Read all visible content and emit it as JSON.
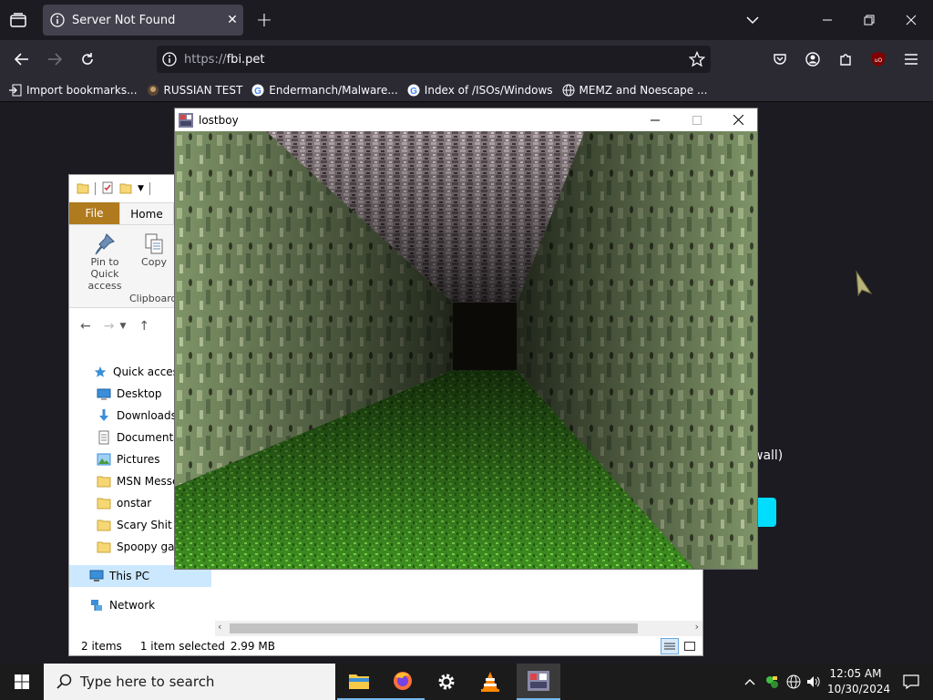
{
  "browser": {
    "tab_title": "Server Not Found",
    "url_scheme": "https://",
    "url_host": "fbi.pet",
    "bookmarks": [
      {
        "label": "Import bookmarks...",
        "icon": "import-icon"
      },
      {
        "label": "RUSSIAN TEST",
        "icon": "site-icon"
      },
      {
        "label": "Endermanch/Malware...",
        "icon": "chrome-favicon"
      },
      {
        "label": "Index of /ISOs/Windows",
        "icon": "chrome-favicon"
      },
      {
        "label": "MEMZ and Noescape ...",
        "icon": "globe-icon"
      }
    ],
    "error_fragment": "wall)",
    "accent_color": "#00ddff"
  },
  "explorer": {
    "tabs": {
      "file": "File",
      "home": "Home"
    },
    "ribbon": {
      "pin_label": "Pin to Quick access",
      "copy_label": "Copy",
      "group_label": "Clipboard"
    },
    "nav": [
      {
        "label": "Quick access",
        "icon": "star-icon"
      },
      {
        "label": "Desktop",
        "icon": "desktop-icon"
      },
      {
        "label": "Downloads",
        "icon": "download-icon"
      },
      {
        "label": "Documents",
        "icon": "document-icon"
      },
      {
        "label": "Pictures",
        "icon": "pictures-icon"
      },
      {
        "label": "MSN Messe",
        "icon": "folder-icon"
      },
      {
        "label": "onstar",
        "icon": "folder-icon"
      },
      {
        "label": "Scary Shit",
        "icon": "folder-icon"
      },
      {
        "label": "Spoopy gam",
        "icon": "folder-icon"
      },
      {
        "label": "This PC",
        "icon": "computer-icon"
      },
      {
        "label": "Network",
        "icon": "network-icon"
      }
    ],
    "status": {
      "items": "2 items",
      "selected": "1 item selected",
      "size": "2.99 MB"
    }
  },
  "game_window": {
    "title": "lostboy"
  },
  "taskbar": {
    "search_placeholder": "Type here to search",
    "time": "12:05 AM",
    "date": "10/30/2024"
  }
}
